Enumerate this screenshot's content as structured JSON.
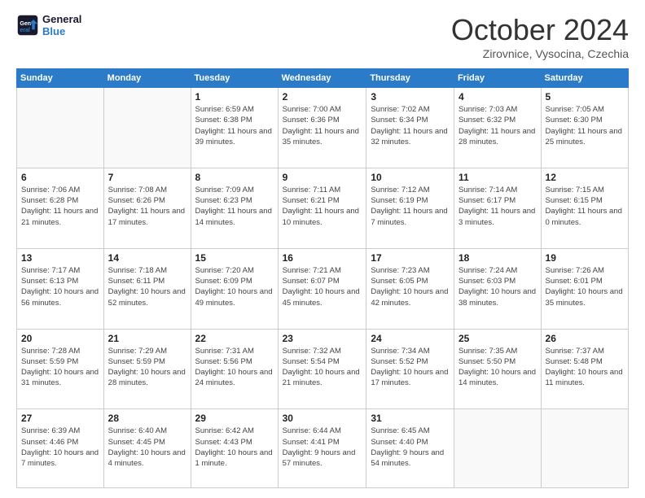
{
  "logo": {
    "line1": "General",
    "line2": "Blue"
  },
  "title": "October 2024",
  "subtitle": "Zirovnice, Vysocina, Czechia",
  "days_header": [
    "Sunday",
    "Monday",
    "Tuesday",
    "Wednesday",
    "Thursday",
    "Friday",
    "Saturday"
  ],
  "weeks": [
    [
      {
        "num": "",
        "info": ""
      },
      {
        "num": "",
        "info": ""
      },
      {
        "num": "1",
        "info": "Sunrise: 6:59 AM\nSunset: 6:38 PM\nDaylight: 11 hours and 39 minutes."
      },
      {
        "num": "2",
        "info": "Sunrise: 7:00 AM\nSunset: 6:36 PM\nDaylight: 11 hours and 35 minutes."
      },
      {
        "num": "3",
        "info": "Sunrise: 7:02 AM\nSunset: 6:34 PM\nDaylight: 11 hours and 32 minutes."
      },
      {
        "num": "4",
        "info": "Sunrise: 7:03 AM\nSunset: 6:32 PM\nDaylight: 11 hours and 28 minutes."
      },
      {
        "num": "5",
        "info": "Sunrise: 7:05 AM\nSunset: 6:30 PM\nDaylight: 11 hours and 25 minutes."
      }
    ],
    [
      {
        "num": "6",
        "info": "Sunrise: 7:06 AM\nSunset: 6:28 PM\nDaylight: 11 hours and 21 minutes."
      },
      {
        "num": "7",
        "info": "Sunrise: 7:08 AM\nSunset: 6:26 PM\nDaylight: 11 hours and 17 minutes."
      },
      {
        "num": "8",
        "info": "Sunrise: 7:09 AM\nSunset: 6:23 PM\nDaylight: 11 hours and 14 minutes."
      },
      {
        "num": "9",
        "info": "Sunrise: 7:11 AM\nSunset: 6:21 PM\nDaylight: 11 hours and 10 minutes."
      },
      {
        "num": "10",
        "info": "Sunrise: 7:12 AM\nSunset: 6:19 PM\nDaylight: 11 hours and 7 minutes."
      },
      {
        "num": "11",
        "info": "Sunrise: 7:14 AM\nSunset: 6:17 PM\nDaylight: 11 hours and 3 minutes."
      },
      {
        "num": "12",
        "info": "Sunrise: 7:15 AM\nSunset: 6:15 PM\nDaylight: 11 hours and 0 minutes."
      }
    ],
    [
      {
        "num": "13",
        "info": "Sunrise: 7:17 AM\nSunset: 6:13 PM\nDaylight: 10 hours and 56 minutes."
      },
      {
        "num": "14",
        "info": "Sunrise: 7:18 AM\nSunset: 6:11 PM\nDaylight: 10 hours and 52 minutes."
      },
      {
        "num": "15",
        "info": "Sunrise: 7:20 AM\nSunset: 6:09 PM\nDaylight: 10 hours and 49 minutes."
      },
      {
        "num": "16",
        "info": "Sunrise: 7:21 AM\nSunset: 6:07 PM\nDaylight: 10 hours and 45 minutes."
      },
      {
        "num": "17",
        "info": "Sunrise: 7:23 AM\nSunset: 6:05 PM\nDaylight: 10 hours and 42 minutes."
      },
      {
        "num": "18",
        "info": "Sunrise: 7:24 AM\nSunset: 6:03 PM\nDaylight: 10 hours and 38 minutes."
      },
      {
        "num": "19",
        "info": "Sunrise: 7:26 AM\nSunset: 6:01 PM\nDaylight: 10 hours and 35 minutes."
      }
    ],
    [
      {
        "num": "20",
        "info": "Sunrise: 7:28 AM\nSunset: 5:59 PM\nDaylight: 10 hours and 31 minutes."
      },
      {
        "num": "21",
        "info": "Sunrise: 7:29 AM\nSunset: 5:59 PM\nDaylight: 10 hours and 28 minutes."
      },
      {
        "num": "22",
        "info": "Sunrise: 7:31 AM\nSunset: 5:56 PM\nDaylight: 10 hours and 24 minutes."
      },
      {
        "num": "23",
        "info": "Sunrise: 7:32 AM\nSunset: 5:54 PM\nDaylight: 10 hours and 21 minutes."
      },
      {
        "num": "24",
        "info": "Sunrise: 7:34 AM\nSunset: 5:52 PM\nDaylight: 10 hours and 17 minutes."
      },
      {
        "num": "25",
        "info": "Sunrise: 7:35 AM\nSunset: 5:50 PM\nDaylight: 10 hours and 14 minutes."
      },
      {
        "num": "26",
        "info": "Sunrise: 7:37 AM\nSunset: 5:48 PM\nDaylight: 10 hours and 11 minutes."
      }
    ],
    [
      {
        "num": "27",
        "info": "Sunrise: 6:39 AM\nSunset: 4:46 PM\nDaylight: 10 hours and 7 minutes."
      },
      {
        "num": "28",
        "info": "Sunrise: 6:40 AM\nSunset: 4:45 PM\nDaylight: 10 hours and 4 minutes."
      },
      {
        "num": "29",
        "info": "Sunrise: 6:42 AM\nSunset: 4:43 PM\nDaylight: 10 hours and 1 minute."
      },
      {
        "num": "30",
        "info": "Sunrise: 6:44 AM\nSunset: 4:41 PM\nDaylight: 9 hours and 57 minutes."
      },
      {
        "num": "31",
        "info": "Sunrise: 6:45 AM\nSunset: 4:40 PM\nDaylight: 9 hours and 54 minutes."
      },
      {
        "num": "",
        "info": ""
      },
      {
        "num": "",
        "info": ""
      }
    ]
  ]
}
